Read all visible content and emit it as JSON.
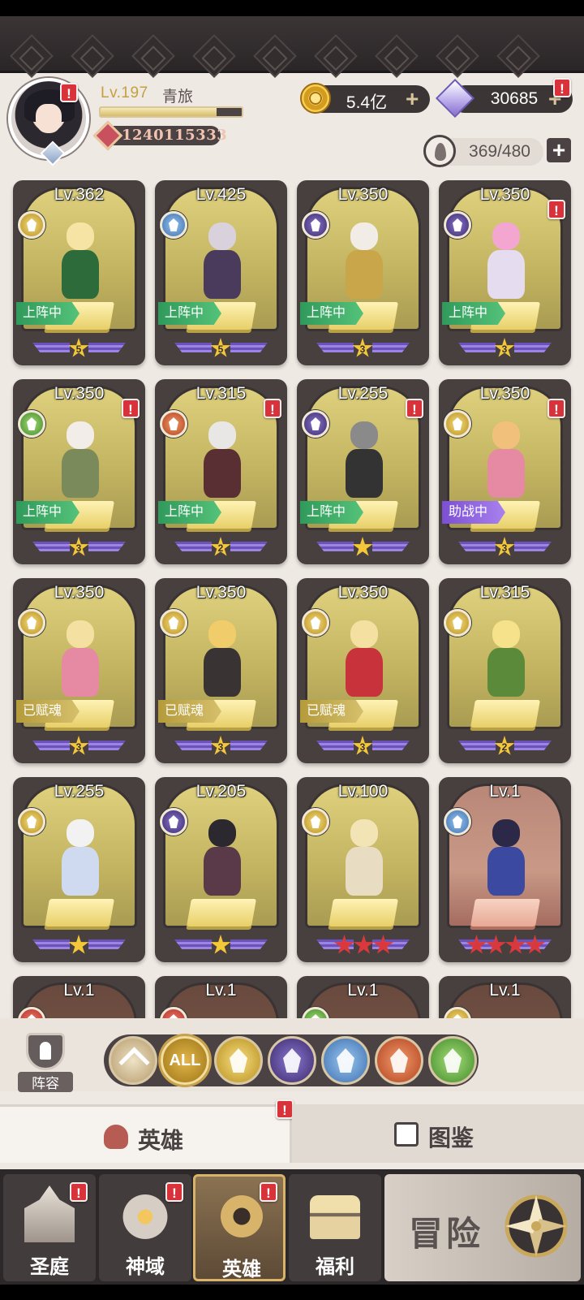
{
  "player": {
    "level": "Lv.197",
    "name": "青旅",
    "exp_fraction": 0.82,
    "power": "1240115333"
  },
  "currency": {
    "gold": "5.4亿",
    "diamonds": "30685",
    "stamina": "369/480",
    "plus": "+"
  },
  "alerts": {
    "mark": "!"
  },
  "heroes": [
    {
      "level": "Lv.362",
      "faction": "light",
      "tag": "上阵中",
      "tag_style": "green",
      "stars": 5,
      "star_color": "gold",
      "alert": false
    },
    {
      "level": "Lv.425",
      "faction": "holy",
      "tag": "上阵中",
      "tag_style": "green",
      "stars": 5,
      "star_color": "gold",
      "alert": false
    },
    {
      "level": "Lv.350",
      "faction": "dark",
      "tag": "上阵中",
      "tag_style": "green",
      "stars": 3,
      "star_color": "gold",
      "alert": false
    },
    {
      "level": "Lv.350",
      "faction": "dark",
      "tag": "上阵中",
      "tag_style": "green",
      "stars": 3,
      "star_color": "gold",
      "alert": true
    },
    {
      "level": "Lv.350",
      "faction": "nature",
      "tag": "上阵中",
      "tag_style": "green",
      "stars": 3,
      "star_color": "gold",
      "alert": true
    },
    {
      "level": "Lv.315",
      "faction": "beast",
      "tag": "上阵中",
      "tag_style": "green",
      "stars": 2,
      "star_color": "gold",
      "alert": true
    },
    {
      "level": "Lv.255",
      "faction": "dark",
      "tag": "上阵中",
      "tag_style": "green",
      "stars": 1,
      "star_color": "gold",
      "alert": true
    },
    {
      "level": "Lv.350",
      "faction": "light",
      "tag": "助战中",
      "tag_style": "purple",
      "stars": 3,
      "star_color": "gold",
      "alert": true
    },
    {
      "level": "Lv.350",
      "faction": "light",
      "tag": "已赋魂",
      "tag_style": "gold",
      "stars": 3,
      "star_color": "gold",
      "alert": false
    },
    {
      "level": "Lv.350",
      "faction": "light",
      "tag": "已赋魂",
      "tag_style": "gold",
      "stars": 3,
      "star_color": "gold",
      "alert": false
    },
    {
      "level": "Lv.350",
      "faction": "light",
      "tag": "已赋魂",
      "tag_style": "gold",
      "stars": 3,
      "star_color": "gold",
      "alert": false
    },
    {
      "level": "Lv.315",
      "faction": "light",
      "tag": "",
      "tag_style": "",
      "stars": 2,
      "star_color": "gold",
      "alert": false
    },
    {
      "level": "Lv.255",
      "faction": "light",
      "tag": "",
      "tag_style": "",
      "stars": 1,
      "star_color": "gold",
      "alert": false
    },
    {
      "level": "Lv.205",
      "faction": "dark",
      "tag": "",
      "tag_style": "",
      "stars": 1,
      "star_color": "gold",
      "alert": false
    },
    {
      "level": "Lv.100",
      "faction": "light",
      "tag": "",
      "tag_style": "",
      "stars": 3,
      "star_color": "red",
      "alert": false
    },
    {
      "level": "Lv.1",
      "faction": "holy",
      "tag": "",
      "tag_style": "",
      "stars": 4,
      "star_color": "red",
      "alert": false,
      "pink": true
    },
    {
      "level": "Lv.1",
      "faction": "red",
      "tag": "",
      "tag_style": "",
      "stars": 0,
      "star_color": "gold",
      "alert": false,
      "dim": true
    },
    {
      "level": "Lv.1",
      "faction": "red",
      "tag": "",
      "tag_style": "",
      "stars": 0,
      "star_color": "gold",
      "alert": false,
      "dim": true
    },
    {
      "level": "Lv.1",
      "faction": "nature",
      "tag": "",
      "tag_style": "",
      "stars": 0,
      "star_color": "gold",
      "alert": false,
      "dim": true
    },
    {
      "level": "Lv.1",
      "faction": "gold",
      "tag": "",
      "tag_style": "",
      "stars": 0,
      "star_color": "gold",
      "alert": false,
      "dim": true
    }
  ],
  "filter": {
    "lineup_label": "阵容",
    "all_label": "ALL",
    "buttons": [
      "up-arrow",
      "all",
      "light",
      "dark",
      "holy",
      "beast",
      "nature"
    ]
  },
  "tabs": {
    "heroes": "英雄",
    "codex": "图鉴"
  },
  "nav": {
    "items": [
      "圣庭",
      "神域",
      "英雄",
      "福利"
    ],
    "active": "英雄",
    "adventure": "冒险"
  },
  "colors": {
    "accent_gold": "#c3a140",
    "alert_red": "#d8323a",
    "deployed_green": "#2f9a5a",
    "assist_purple": "#7c4fd4"
  }
}
